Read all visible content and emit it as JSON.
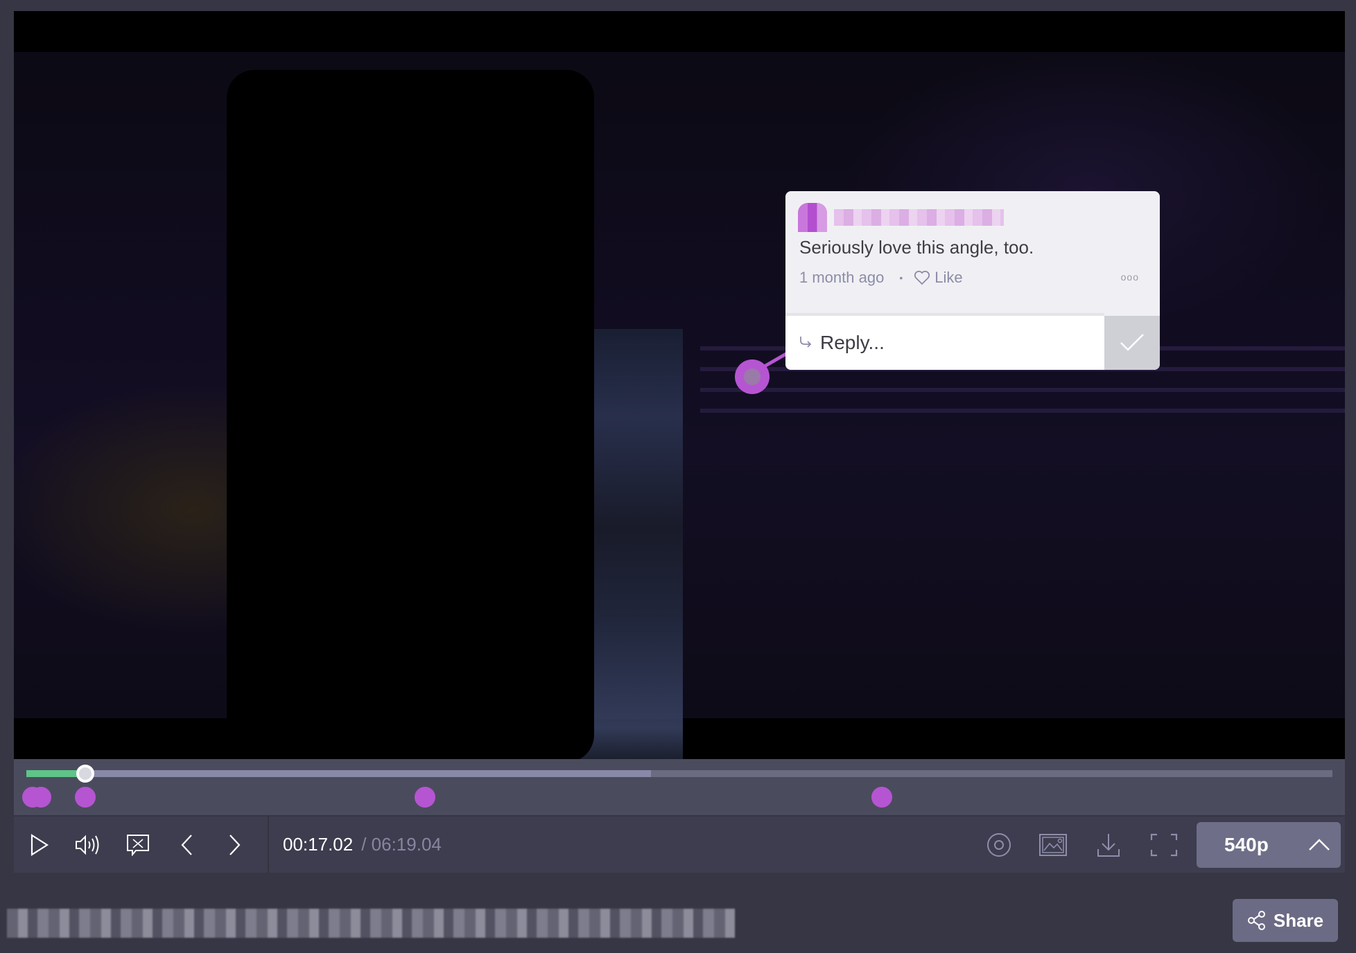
{
  "video": {
    "comment": {
      "author": "",
      "text": "Seriously love this angle, too.",
      "timestamp": "1 month ago",
      "separator": "•",
      "like_label": "Like",
      "more_label": "ooo",
      "reply_placeholder": "Reply..."
    }
  },
  "timeline": {
    "progress_fraction": 0.045,
    "buffered_fraction": 0.478,
    "comment_markers_fraction": [
      0.005,
      0.011,
      0.045,
      0.305,
      0.655
    ]
  },
  "controls": {
    "current_time": "00:17.02",
    "total_time": "/ 06:19.04",
    "quality": "540p",
    "icons": [
      "play-icon",
      "volume-icon",
      "comments-toggle-icon",
      "previous-icon",
      "next-icon",
      "target-icon",
      "screenshot-icon",
      "download-icon",
      "fullscreen-icon",
      "chevron-up-icon"
    ]
  },
  "footer": {
    "title": "",
    "share_label": "Share"
  },
  "colors": {
    "accent_comment": "#b655d2",
    "progress": "#5ec487",
    "background": "#363644"
  }
}
